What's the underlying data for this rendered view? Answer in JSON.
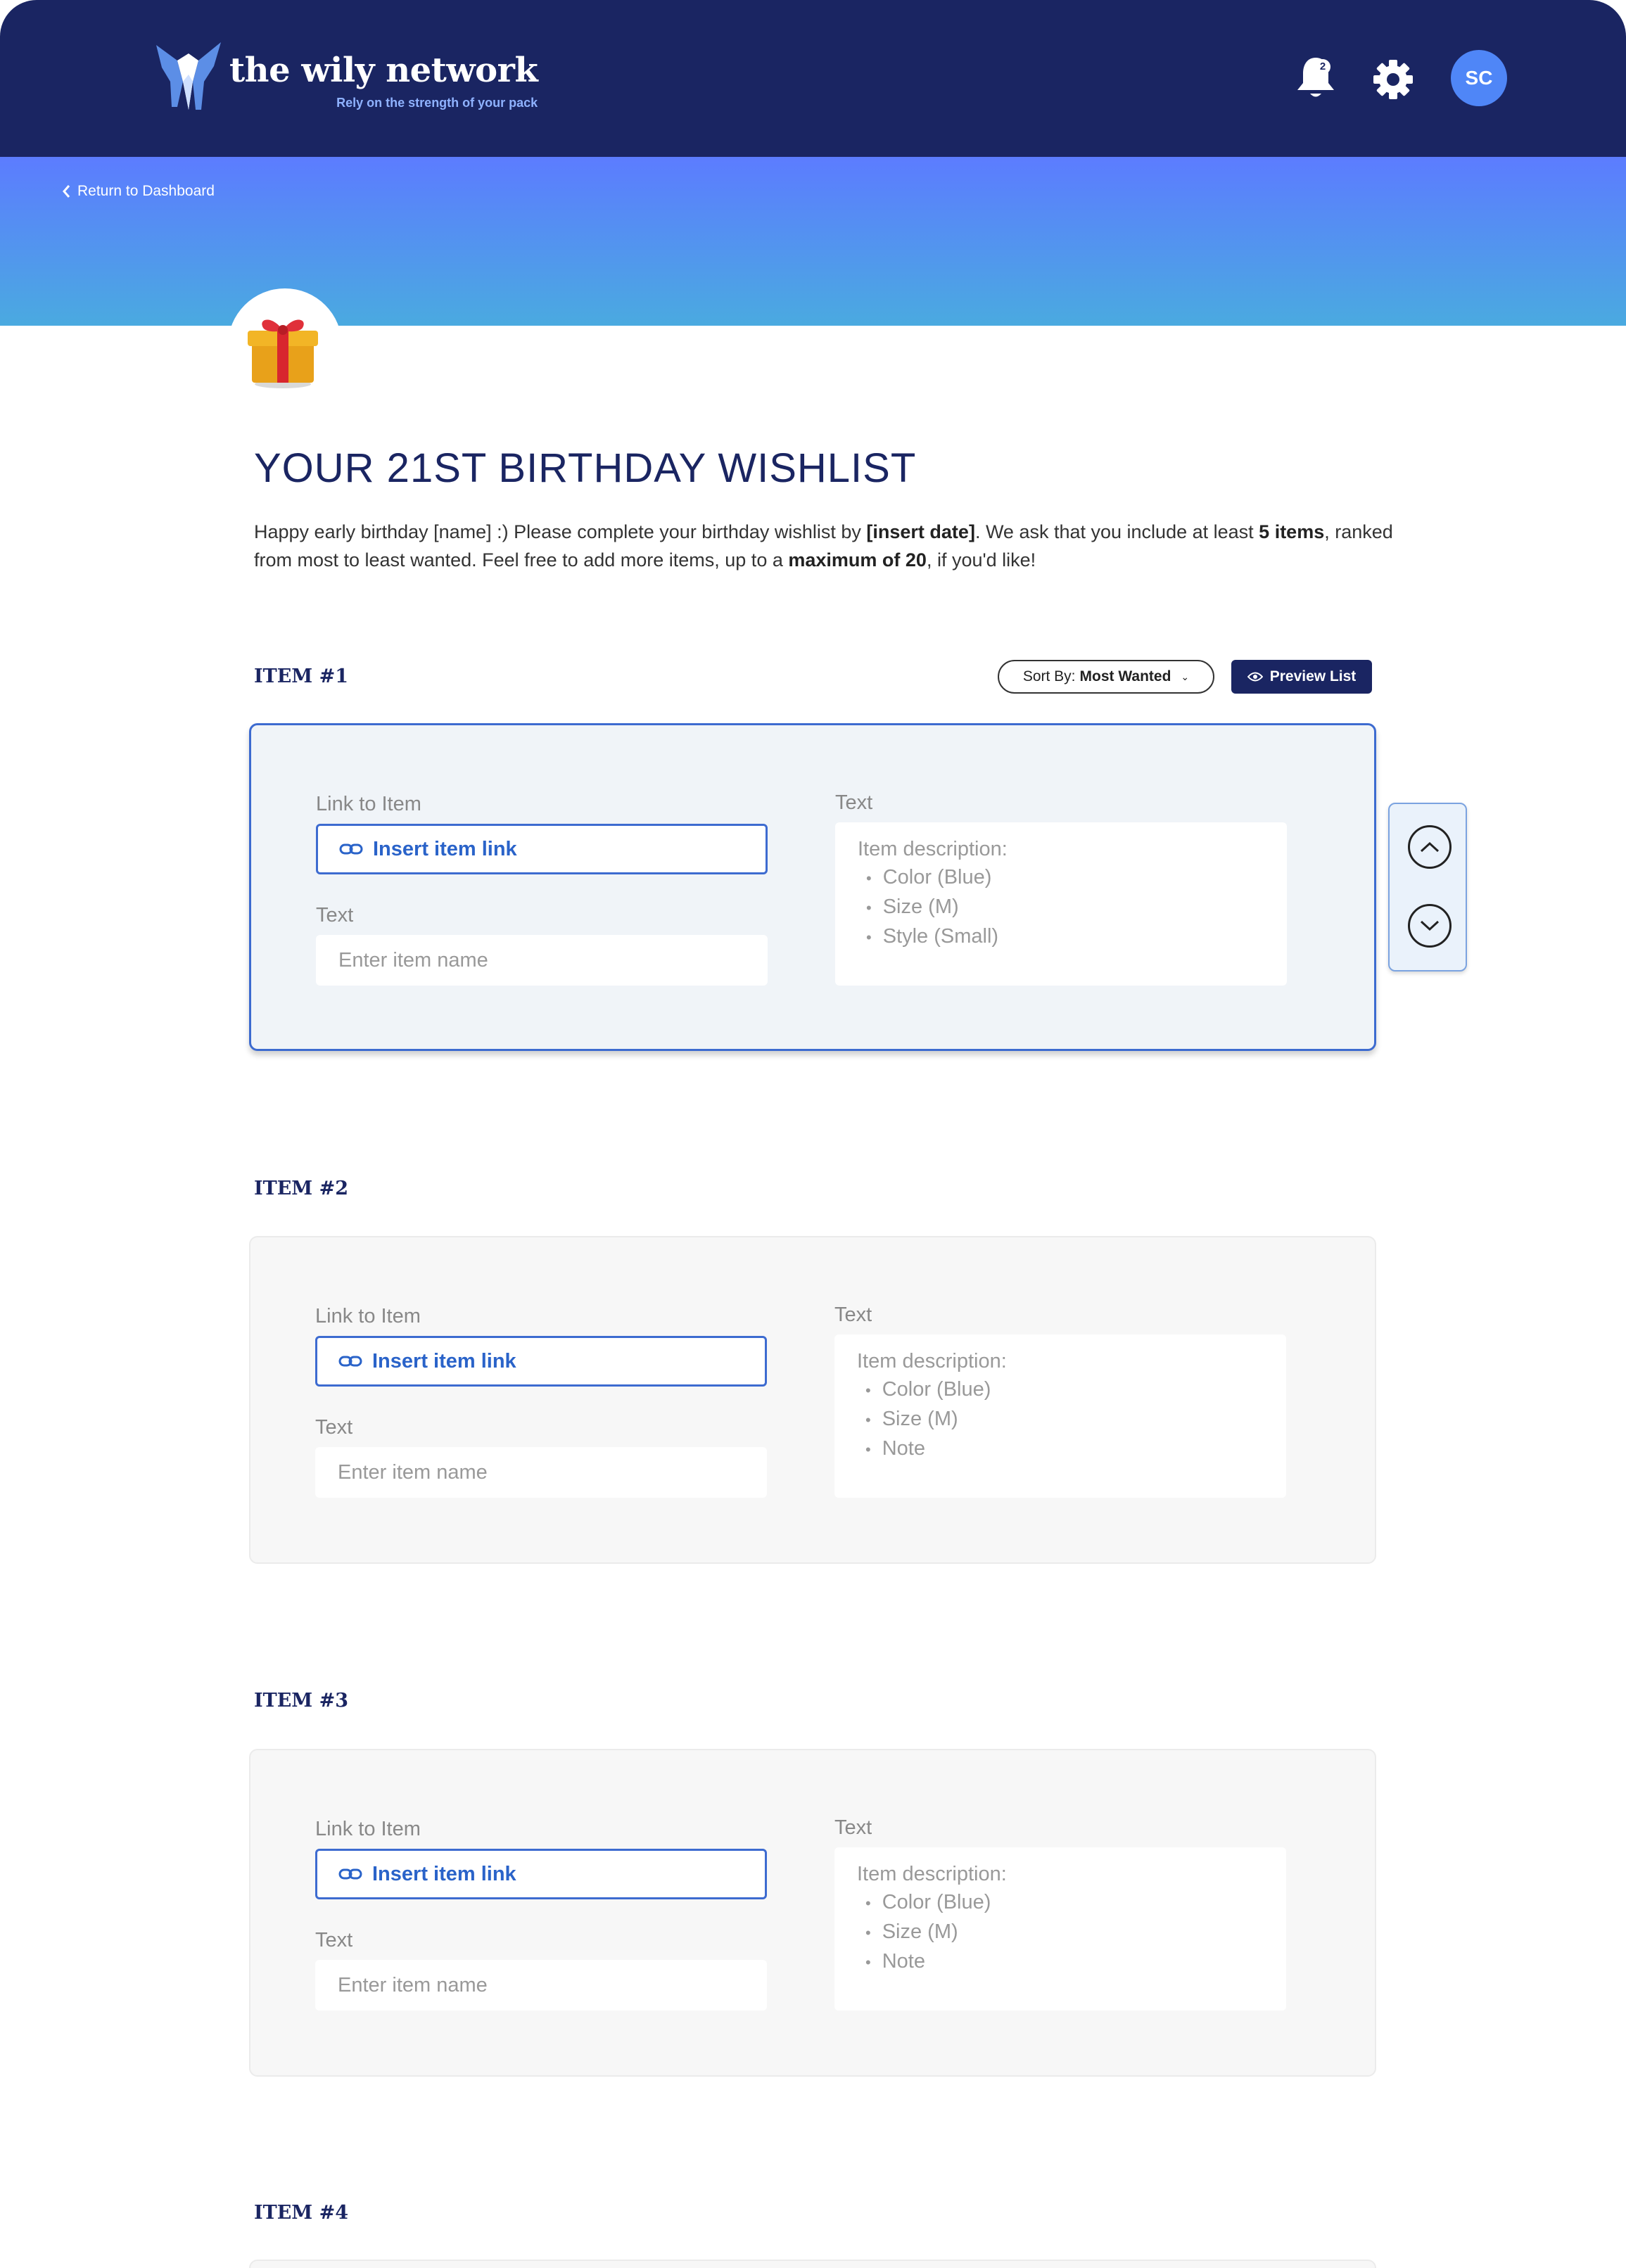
{
  "header": {
    "logo_title": "the wily network",
    "logo_tagline": "Rely on the strength of your pack",
    "notification_count": "2",
    "avatar_initials": "SC",
    "brand_color": "#1a2562"
  },
  "nav": {
    "back_label": "Return to Dashboard"
  },
  "page": {
    "title": "YOUR 21ST BIRTHDAY WISHLIST",
    "intro": {
      "part1": "Happy early birthday [name] :) Please complete your birthday wishlist by ",
      "bold1": "[insert date]",
      "part2": ". We ask that you include at least ",
      "bold2": "5 items",
      "part3": ", ranked from most to least wanted. Feel free to add more items, up to a ",
      "bold3": "maximum of 20",
      "part4": ", if you'd like!"
    }
  },
  "controls": {
    "sort_prefix": "Sort By:",
    "sort_value": "Most Wanted",
    "preview_label": "Preview List"
  },
  "items": [
    {
      "heading": "ITEM #1",
      "link_label": "Link to Item",
      "link_placeholder": "Insert item link",
      "name_label": "Text",
      "name_placeholder": "Enter item name",
      "desc_label": "Text",
      "desc_title": "Item description:",
      "desc_bullets": [
        "Color (Blue)",
        "Size (M)",
        "Style (Small)"
      ]
    },
    {
      "heading": "ITEM #2",
      "link_label": "Link to Item",
      "link_placeholder": "Insert item link",
      "name_label": "Text",
      "name_placeholder": "Enter item name",
      "desc_label": "Text",
      "desc_title": "Item description:",
      "desc_bullets": [
        "Color (Blue)",
        "Size (M)",
        "Note"
      ]
    },
    {
      "heading": "ITEM #3",
      "link_label": "Link to Item",
      "link_placeholder": "Insert item link",
      "name_label": "Text",
      "name_placeholder": "Enter item name",
      "desc_label": "Text",
      "desc_title": "Item description:",
      "desc_bullets": [
        "Color (Blue)",
        "Size (M)",
        "Note"
      ]
    },
    {
      "heading": "ITEM #4"
    }
  ],
  "icons": {
    "logo": "wolf-logo-icon",
    "bell": "bell-icon",
    "gear": "gear-icon",
    "back": "chevron-left-icon",
    "gift": "gift-icon",
    "eye": "eye-icon",
    "link": "link-icon",
    "up": "chevron-up-icon",
    "down": "chevron-down-icon"
  }
}
